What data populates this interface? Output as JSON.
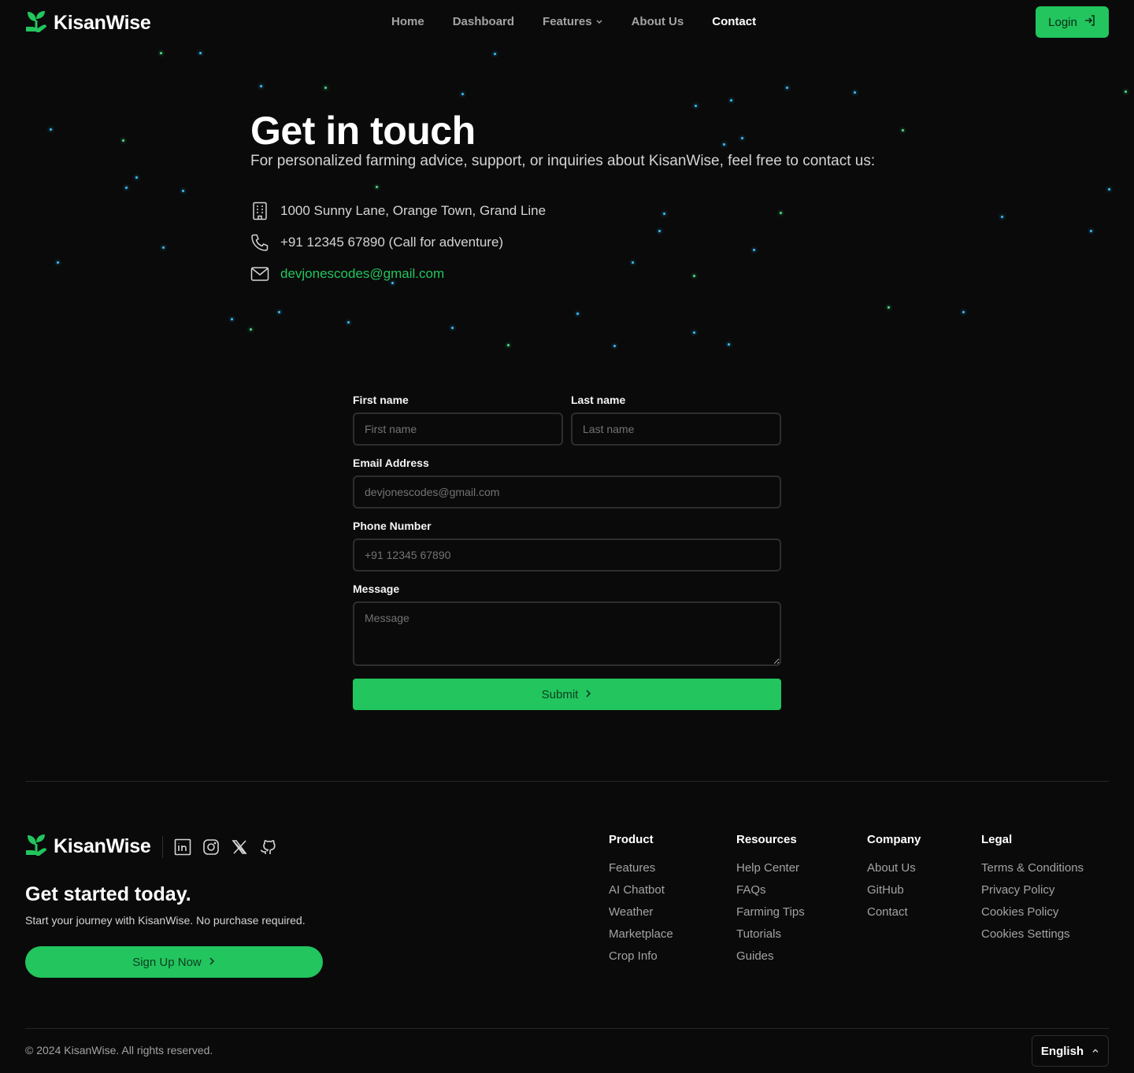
{
  "header": {
    "logo_text": "KisanWise",
    "nav": [
      {
        "label": "Home"
      },
      {
        "label": "Dashboard"
      },
      {
        "label": "Features"
      },
      {
        "label": "About Us"
      },
      {
        "label": "Contact"
      }
    ],
    "active_nav": "Contact",
    "login_label": "Login"
  },
  "hero": {
    "title": "Get in touch",
    "subtitle": "For personalized farming advice, support, or inquiries about KisanWise, feel free to contact us:",
    "address": "1000 Sunny Lane, Orange Town, Grand Line",
    "phone": "+91 12345 67890 (Call for adventure)",
    "email": "devjonescodes@gmail.com"
  },
  "form": {
    "first_name_label": "First name",
    "first_name_placeholder": "First name",
    "last_name_label": "Last name",
    "last_name_placeholder": "Last name",
    "email_label": "Email Address",
    "email_placeholder": "devjonescodes@gmail.com",
    "phone_label": "Phone Number",
    "phone_placeholder": "+91 12345 67890",
    "message_label": "Message",
    "message_placeholder": "Message",
    "submit_label": "Submit"
  },
  "footer": {
    "logo_text": "KisanWise",
    "socials": [
      "linkedin-icon",
      "instagram-icon",
      "x-icon",
      "github-icon"
    ],
    "cta_title": "Get started today.",
    "cta_text": "Start your journey with KisanWise. No purchase required.",
    "signup_label": "Sign Up Now",
    "columns": [
      {
        "title": "Product",
        "links": [
          "Features",
          "AI Chatbot",
          "Weather",
          "Marketplace",
          "Crop Info"
        ]
      },
      {
        "title": "Resources",
        "links": [
          "Help Center",
          "FAQs",
          "Farming Tips",
          "Tutorials",
          "Guides"
        ]
      },
      {
        "title": "Company",
        "links": [
          "About Us",
          "GitHub",
          "Contact"
        ]
      },
      {
        "title": "Legal",
        "links": [
          "Terms & Conditions",
          "Privacy Policy",
          "Cookies Policy",
          "Cookies Settings"
        ]
      }
    ],
    "copyright": "© 2024 KisanWise. All rights reserved.",
    "language": "English"
  },
  "colors": {
    "background": "#0a0a0a",
    "accent": "#22c55e",
    "text": "#e5e5e5",
    "muted": "#a3a3a3",
    "star_blue": "#38bdf8",
    "star_green": "#4ade80"
  }
}
